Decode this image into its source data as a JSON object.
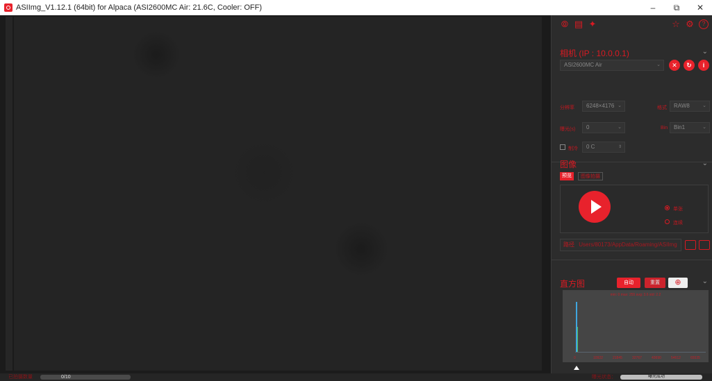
{
  "window": {
    "title": "ASIImg_V1.12.1 (64bit) for Alpaca  (ASI2600MC Air: 21.6C, Cooler: OFF)",
    "min": "–",
    "restore": "⧉",
    "close": "✕"
  },
  "toolbar": {
    "icons": [
      "target-icon",
      "camera-mount-icon",
      "telescope-icon",
      "shirt-icon",
      "settings-icon",
      "help-icon"
    ]
  },
  "camera": {
    "title": "相机 (IP : 10.0.0.1)",
    "device": "ASI2600MC Air",
    "resolution_label": "分辨率",
    "resolution_value": "6248×4176",
    "format_label": "格式",
    "format_value": "RAW8",
    "exposure_label": "曝光(s)",
    "exposure_value": "0",
    "bin_label": "Bin",
    "bin_value": "Bin1",
    "temp_label": "制冷",
    "temp_value": "0 C"
  },
  "image": {
    "title": "图像",
    "tab_preview": "预览",
    "tab_seq": "图像拍摄",
    "radio_single": "单张",
    "radio_loop": "连续",
    "path_label": "路径",
    "path_value": "Users/80173/AppData/Roaming/ASIImg"
  },
  "histogram": {
    "title": "直方图",
    "auto": "自动",
    "reset": "重置",
    "zoom": "⊕",
    "header": "min: 0  max: 255  avg: 3.6  std: 2.2",
    "ticks": [
      "0",
      "10922",
      "21845",
      "32767",
      "43690",
      "54612",
      "65535"
    ]
  },
  "status": {
    "left_label": "已拍摄数量",
    "progress": "0/10",
    "right_label": "曝光状态：",
    "right_text": "曝光成功"
  },
  "colors": {
    "accent": "#e8222c",
    "panel_bg": "#2c2c2c",
    "preview_bg": "#242424"
  }
}
